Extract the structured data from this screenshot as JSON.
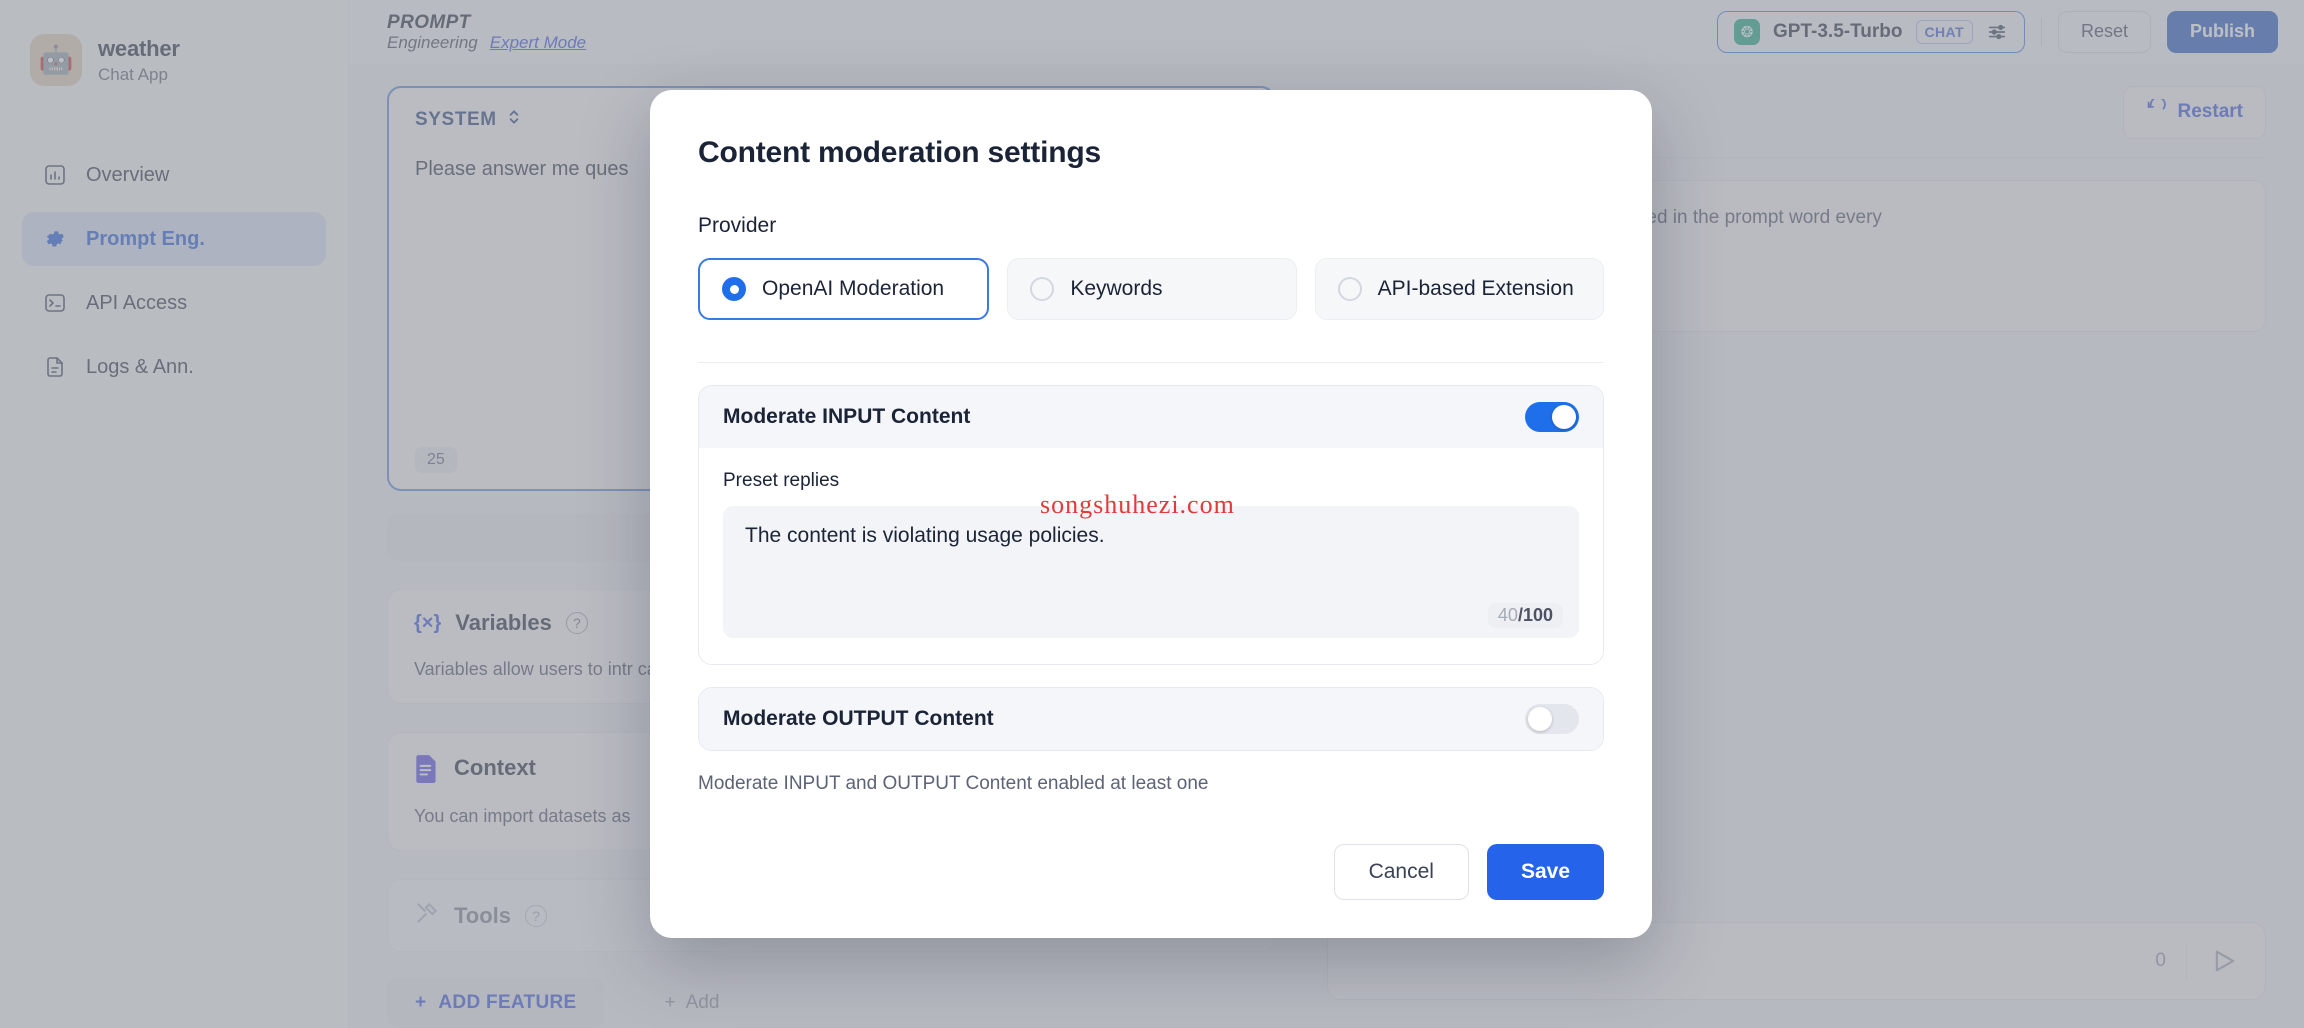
{
  "sidebar": {
    "app_name": "weather",
    "app_type": "Chat App",
    "avatar_glyph": "🤖",
    "items": [
      {
        "label": "Overview",
        "icon": "chart-icon"
      },
      {
        "label": "Prompt Eng.",
        "icon": "gear-icon"
      },
      {
        "label": "API Access",
        "icon": "terminal-icon"
      },
      {
        "label": "Logs & Ann.",
        "icon": "document-icon"
      }
    ],
    "active_index": 1
  },
  "topbar": {
    "brand_line1": "PROMPT",
    "brand_line2": "Engineering",
    "expert_mode": "Expert Mode",
    "model_name": "GPT-3.5-Turbo",
    "model_tag": "CHAT",
    "reset_label": "Reset",
    "publish_label": "Publish"
  },
  "left_pane": {
    "system_label": "SYSTEM",
    "system_text": "Please answer me ques",
    "system_count": "25",
    "variables": {
      "title": "Variables",
      "body": "Variables allow users to intr\ncan try entering \"{{input}}\""
    },
    "context": {
      "title": "Context",
      "body": "You can import datasets as"
    },
    "tools": {
      "title": "Tools"
    },
    "add_feature": "ADD FEATURE",
    "add_small": "Add"
  },
  "right_pane": {
    "restart_label": "Restart",
    "debug_text": ", which will be automatically replaced in the prompt word every",
    "chat_count": "0"
  },
  "modal": {
    "title": "Content moderation settings",
    "provider_label": "Provider",
    "providers": [
      {
        "label": "OpenAI Moderation",
        "selected": true
      },
      {
        "label": "Keywords",
        "selected": false
      },
      {
        "label": "API-based Extension",
        "selected": false
      }
    ],
    "input_panel": {
      "title": "Moderate INPUT Content",
      "enabled": true,
      "preset_label": "Preset replies",
      "preset_value": "The content is violating usage policies.",
      "counter_current": "40",
      "counter_max": "/100"
    },
    "output_panel": {
      "title": "Moderate OUTPUT Content",
      "enabled": false
    },
    "helper_text": "Moderate INPUT and OUTPUT Content enabled at least one",
    "cancel_label": "Cancel",
    "save_label": "Save"
  },
  "watermark": "songshuhezi.com",
  "colors": {
    "accent_blue": "#1f6feb",
    "primary_button": "#2563eb",
    "publish_button": "#1f56c3",
    "active_nav_bg": "#d4dff3",
    "openai_green": "#10a37f",
    "watermark_red": "#e03a3a"
  }
}
